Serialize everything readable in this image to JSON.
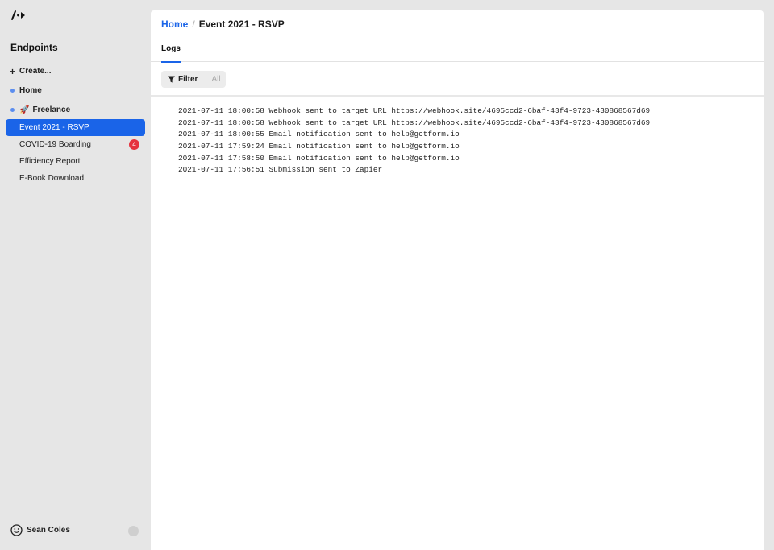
{
  "sidebar": {
    "title": "Endpoints",
    "create_label": "Create...",
    "items": [
      {
        "label": "Home"
      },
      {
        "label": "Freelance",
        "emoji": "🚀"
      }
    ],
    "sub_items": [
      {
        "label": "Event 2021 - RSVP",
        "active": true
      },
      {
        "label": "COVID-19 Boarding",
        "badge": "4"
      },
      {
        "label": "Efficiency Report"
      },
      {
        "label": "E-Book Download"
      }
    ],
    "user": {
      "name": "Sean Coles",
      "more": "···"
    }
  },
  "main": {
    "breadcrumb": {
      "home": "Home",
      "separator": "/",
      "current": "Event 2021 - RSVP"
    },
    "tabs": [
      {
        "label": "Logs",
        "active": true
      }
    ],
    "filter": {
      "label": "Filter",
      "value": "All"
    },
    "logs": [
      "2021-07-11 18:00:58 Webhook sent to target URL https://webhook.site/4695ccd2-6baf-43f4-9723-430868567d69",
      "2021-07-11 18:00:58 Webhook sent to target URL https://webhook.site/4695ccd2-6baf-43f4-9723-430868567d69",
      "2021-07-11 18:00:55 Email notification sent to help@getform.io",
      "2021-07-11 17:59:24 Email notification sent to help@getform.io",
      "2021-07-11 17:58:50 Email notification sent to help@getform.io",
      "2021-07-11 17:56:51 Submission sent to Zapier"
    ]
  },
  "colors": {
    "accent": "#1a64e8",
    "badge": "#e5343f",
    "dot": "#5b8def"
  }
}
